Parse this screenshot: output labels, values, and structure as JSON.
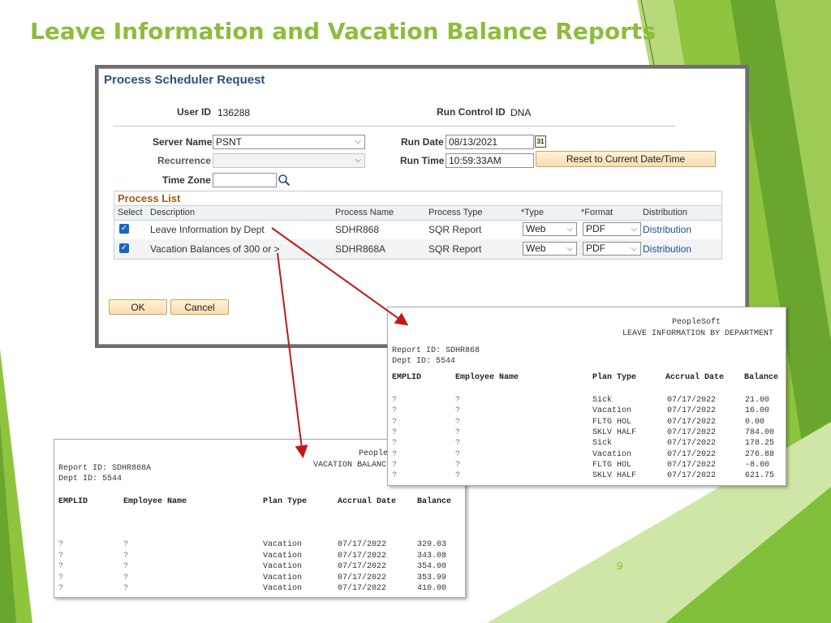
{
  "slide": {
    "title": "Leave Information and Vacation Balance Reports",
    "page_number": "9"
  },
  "colors": {
    "title_green": "#8cbd3b",
    "link_blue": "#1f4f8f",
    "arrow_red": "#c0181a",
    "grid_title_brown": "#a05a18"
  },
  "scheduler": {
    "header": "Process Scheduler Request",
    "user_id_label": "User ID",
    "user_id": "136288",
    "run_control_label": "Run Control ID",
    "run_control": "DNA",
    "server_name_label": "Server Name",
    "server_name": "PSNT",
    "recurrence_label": "Recurrence",
    "recurrence": "",
    "time_zone_label": "Time Zone",
    "time_zone": "",
    "run_date_label": "Run Date",
    "run_date": "08/13/2021",
    "run_time_label": "Run Time",
    "run_time": "10:59:33AM",
    "calendar_icon_text": "31",
    "reset_button": "Reset to Current Date/Time",
    "ok_button": "OK",
    "cancel_button": "Cancel"
  },
  "process_list": {
    "title": "Process List",
    "headers": [
      "Select",
      "Description",
      "Process Name",
      "Process Type",
      "*Type",
      "*Format",
      "Distribution"
    ],
    "rows": [
      {
        "selected": true,
        "description": "Leave Information by Dept",
        "process_name": "SDHR868",
        "process_type": "SQR Report",
        "type": "Web",
        "format": "PDF",
        "distribution": "Distribution"
      },
      {
        "selected": true,
        "description": "Vacation Balances of 300 or >",
        "process_name": "SDHR868A",
        "process_type": "SQR Report",
        "type": "Web",
        "format": "PDF",
        "distribution": "Distribution"
      }
    ]
  },
  "report1": {
    "company": "PeopleSoft",
    "title": "LEAVE INFORMATION BY DEPARTMENT",
    "report_id": "Report ID:  SDHR868",
    "dept_id": "Dept ID: 5544",
    "headers": [
      "EMPLID",
      "Employee Name",
      "Plan Type",
      "Accrual Date",
      "Balance"
    ],
    "rows": [
      {
        "emplid": "?",
        "name": "?",
        "plan": "Sick",
        "date": "07/17/2022",
        "balance": "21.00"
      },
      {
        "emplid": "?",
        "name": "?",
        "plan": "Vacation",
        "date": "07/17/2022",
        "balance": "16.00"
      },
      {
        "emplid": "?",
        "name": "?",
        "plan": "FLTG HOL",
        "date": "07/17/2022",
        "balance": "0.00"
      },
      {
        "emplid": "?",
        "name": "?",
        "plan": "SKLV HALF",
        "date": "07/17/2022",
        "balance": "784.00"
      },
      {
        "emplid": "?",
        "name": "?",
        "plan": "Sick",
        "date": "07/17/2022",
        "balance": "178.25"
      },
      {
        "emplid": "?",
        "name": "?",
        "plan": "Vacation",
        "date": "07/17/2022",
        "balance": "276.88"
      },
      {
        "emplid": "?",
        "name": "?",
        "plan": "FLTG HOL",
        "date": "07/17/2022",
        "balance": "-8.00"
      },
      {
        "emplid": "?",
        "name": "?",
        "plan": "SKLV HALF",
        "date": "07/17/2022",
        "balance": "621.75"
      }
    ]
  },
  "report2": {
    "company": "People",
    "title": "VACATION BALANC",
    "report_id": "Report ID:  SDHR868A",
    "dept_id": "Dept ID: 5544",
    "headers": [
      "EMPLID",
      "Employee Name",
      "Plan Type",
      "Accrual Date",
      "Balance"
    ],
    "rows": [
      {
        "emplid": "?",
        "name": "?",
        "plan": "Vacation",
        "date": "07/17/2022",
        "balance": "329.03"
      },
      {
        "emplid": "?",
        "name": "?",
        "plan": "Vacation",
        "date": "07/17/2022",
        "balance": "343.08"
      },
      {
        "emplid": "?",
        "name": "?",
        "plan": "Vacation",
        "date": "07/17/2022",
        "balance": "354.00"
      },
      {
        "emplid": "?",
        "name": "?",
        "plan": "Vacation",
        "date": "07/17/2022",
        "balance": "353.99"
      },
      {
        "emplid": "?",
        "name": "?",
        "plan": "Vacation",
        "date": "07/17/2022",
        "balance": "410.00"
      }
    ]
  }
}
